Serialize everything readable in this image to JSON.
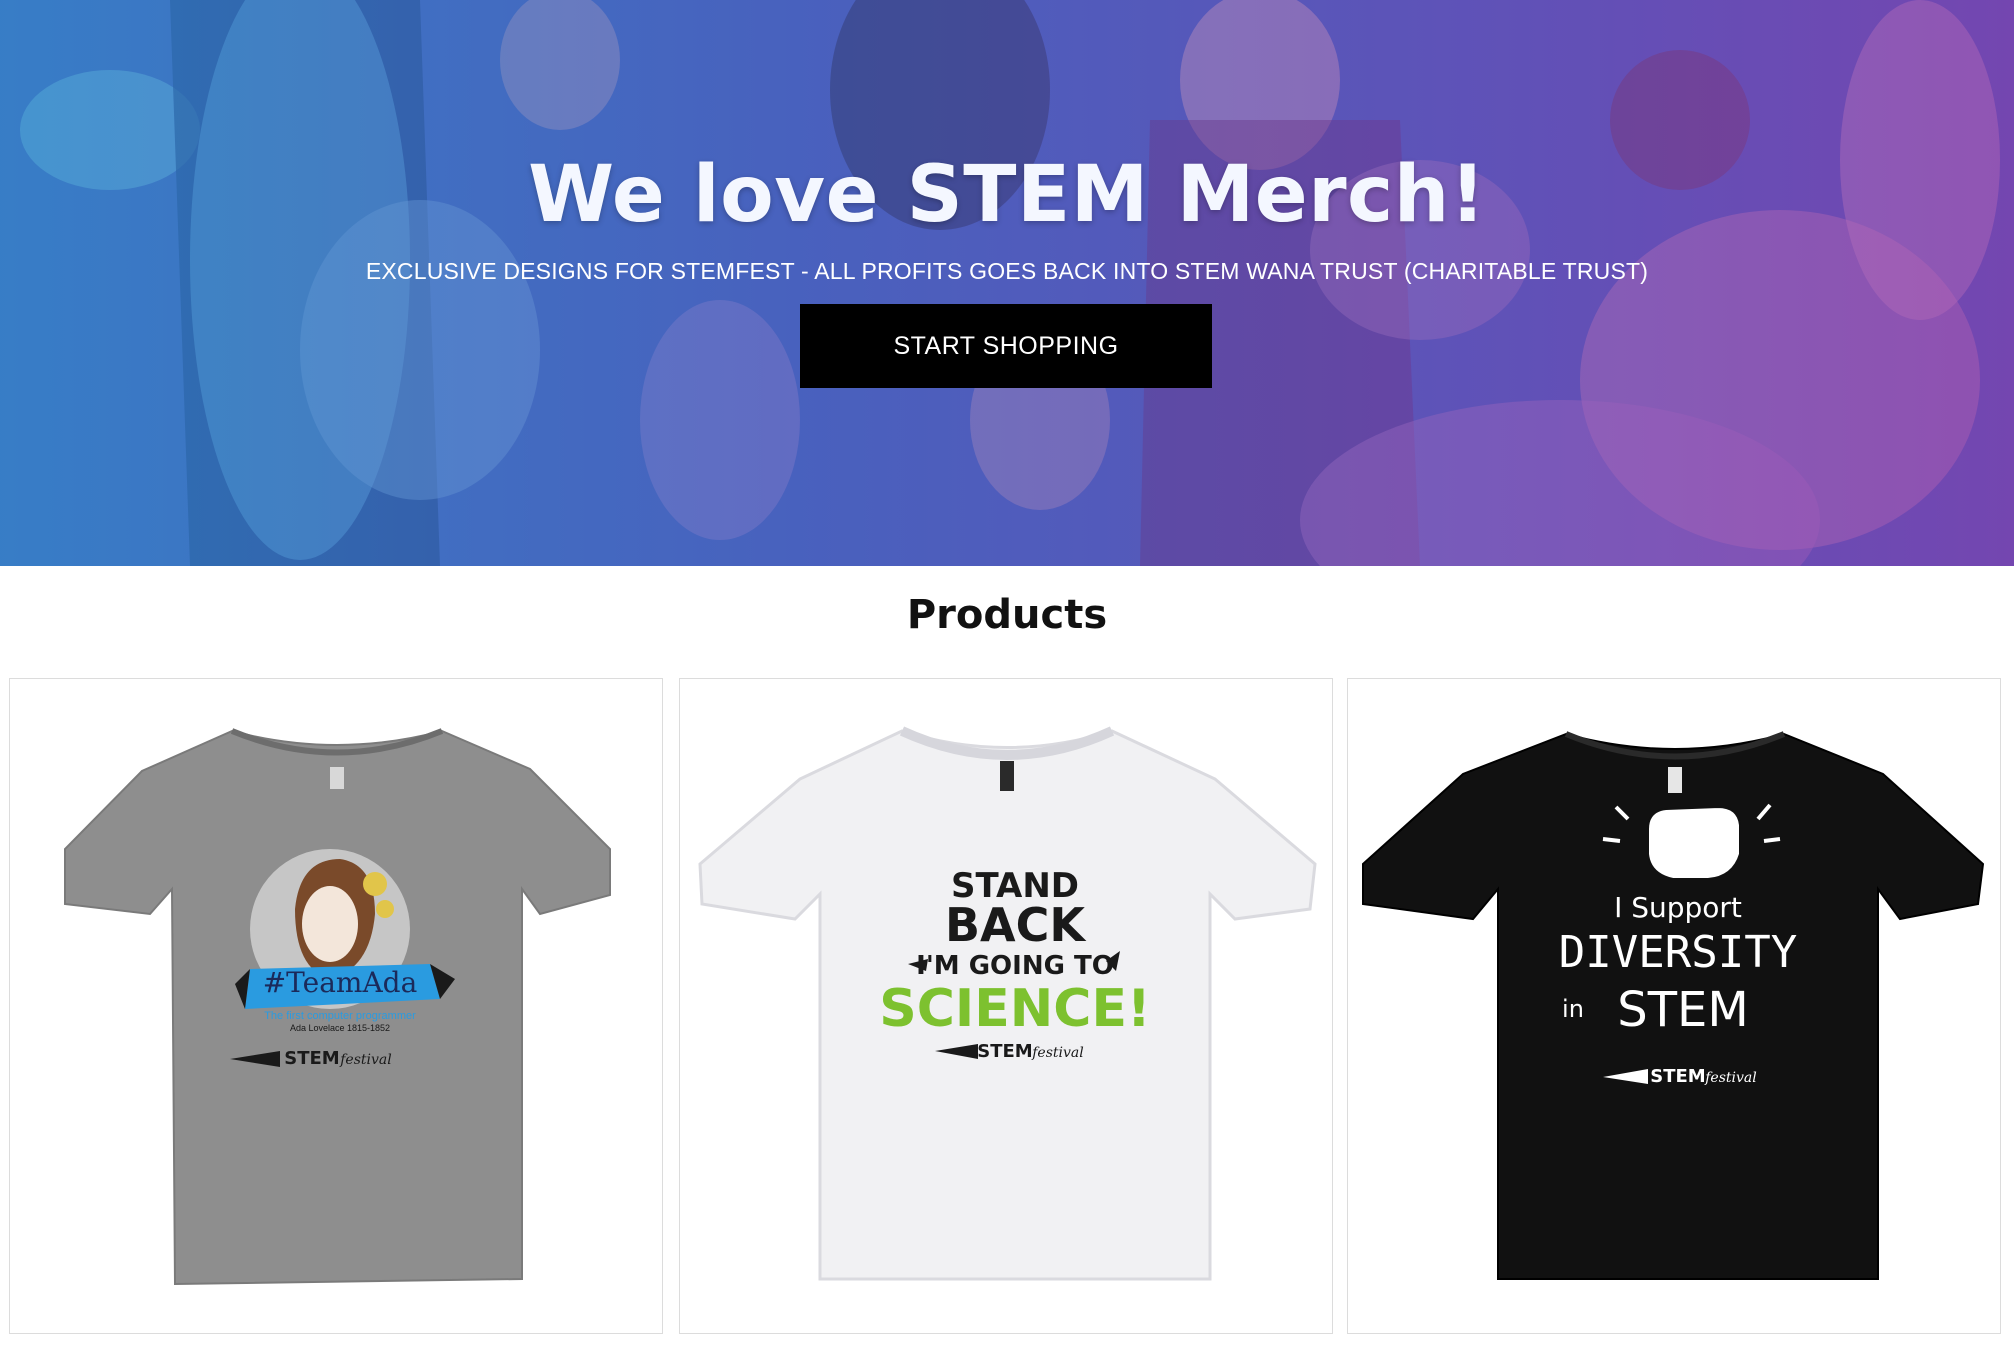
{
  "hero": {
    "title": "We love STEM Merch!",
    "subtitle": "EXCLUSIVE DESIGNS FOR STEMFEST - ALL PROFITS GOES BACK INTO STEM WANA TRUST (CHARITABLE TRUST)",
    "cta_label": "START SHOPPING"
  },
  "products": {
    "heading": "Products",
    "items": [
      {
        "shirt_color": "#8e8e8e",
        "print": {
          "hashtag": "#TeamAda",
          "tagline": "The first computer programmer",
          "name_line": "Ada Lovelace 1815-1852",
          "brand": "STEM",
          "brand_script": "festival"
        }
      },
      {
        "shirt_color": "#f1f1f3",
        "print": {
          "line1": "STAND",
          "line2": "BACK",
          "line3": "I'M GOING TO",
          "line4": "SCIENCE!",
          "brand": "STEM",
          "brand_script": "festival"
        }
      },
      {
        "shirt_color": "#111111",
        "print": {
          "line1": "I Support",
          "line2": "DIVERSITY",
          "line3_small": "in",
          "line3": "STEM",
          "brand": "STEM",
          "brand_script": "festival"
        }
      }
    ]
  },
  "colors": {
    "accent_green": "#7dc12f",
    "ribbon_blue": "#2a9be0",
    "button_black": "#000000"
  }
}
